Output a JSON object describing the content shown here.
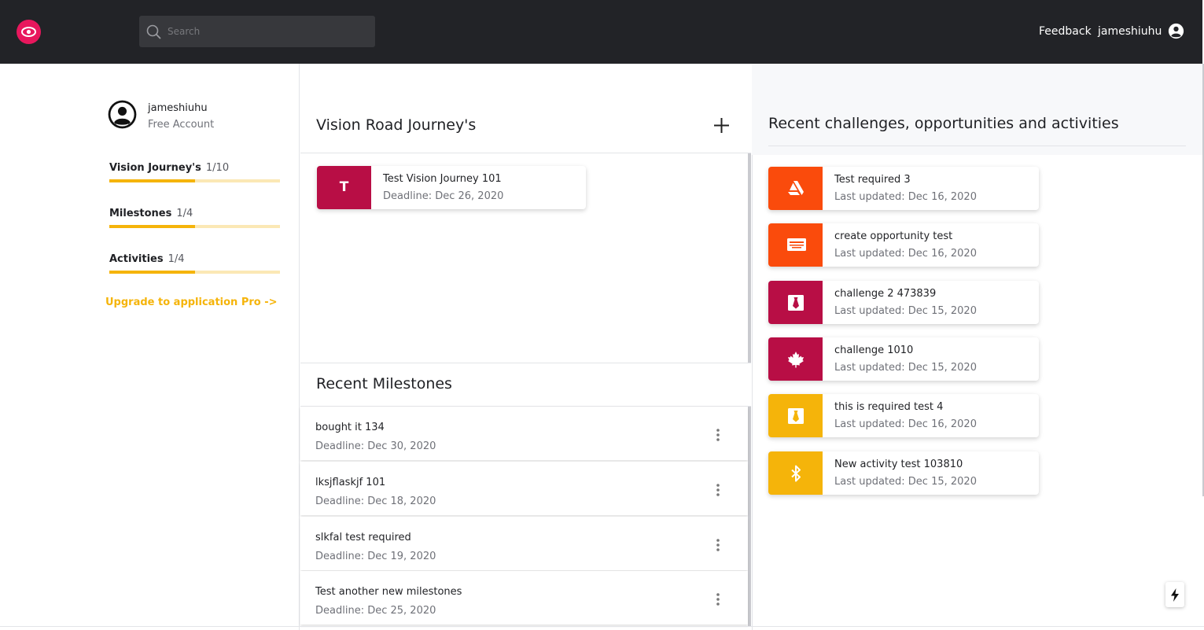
{
  "header": {
    "search_placeholder": "Search",
    "feedback_label": "Feedback",
    "username": "jameshiuhu"
  },
  "profile": {
    "name": "jameshiuhu",
    "plan": "Free Account"
  },
  "stats": [
    {
      "label": "Vision Journey's",
      "count": "1/10",
      "progress": 0.5
    },
    {
      "label": "Milestones",
      "count": "1/4",
      "progress": 0.5
    },
    {
      "label": "Activities",
      "count": "1/4",
      "progress": 0.5
    }
  ],
  "upgrade_link": "Upgrade to application Pro ->",
  "journeys": {
    "title": "Vision Road Journey's",
    "items": [
      {
        "initial": "T",
        "title": "Test Vision Journey 101",
        "deadline": "Deadline: Dec 26, 2020",
        "color": "#b80e45"
      }
    ]
  },
  "milestones": {
    "title": "Recent Milestones",
    "items": [
      {
        "title": "bought it 134",
        "deadline": "Deadline: Dec 30, 2020"
      },
      {
        "title": "lksjflaskjf 101",
        "deadline": "Deadline: Dec 18, 2020"
      },
      {
        "title": "slkfal test required",
        "deadline": "Deadline: Dec 19, 2020"
      },
      {
        "title": "Test another new milestones",
        "deadline": "Deadline: Dec 25, 2020"
      }
    ]
  },
  "activities": {
    "title": "Recent challenges, opportunities and activities",
    "items": [
      {
        "title": "Test required 3",
        "updated": "Last updated: Dec 16, 2020",
        "color": "#fa4b0c",
        "icon": "artstation-icon"
      },
      {
        "title": "create opportunity test",
        "updated": "Last updated: Dec 16, 2020",
        "color": "#fa4b0c",
        "icon": "card-icon"
      },
      {
        "title": "challenge 2 473839",
        "updated": "Last updated: Dec 15, 2020",
        "color": "#b80e45",
        "icon": "tie-icon"
      },
      {
        "title": "challenge 1010",
        "updated": "Last updated: Dec 15, 2020",
        "color": "#b80e45",
        "icon": "maple-leaf-icon"
      },
      {
        "title": "this is required test 4",
        "updated": "Last updated: Dec 16, 2020",
        "color": "#f5b40a",
        "icon": "tie-icon"
      },
      {
        "title": "New activity test 103810",
        "updated": "Last updated: Dec 15, 2020",
        "color": "#f5b40a",
        "icon": "bluetooth-icon"
      }
    ]
  }
}
